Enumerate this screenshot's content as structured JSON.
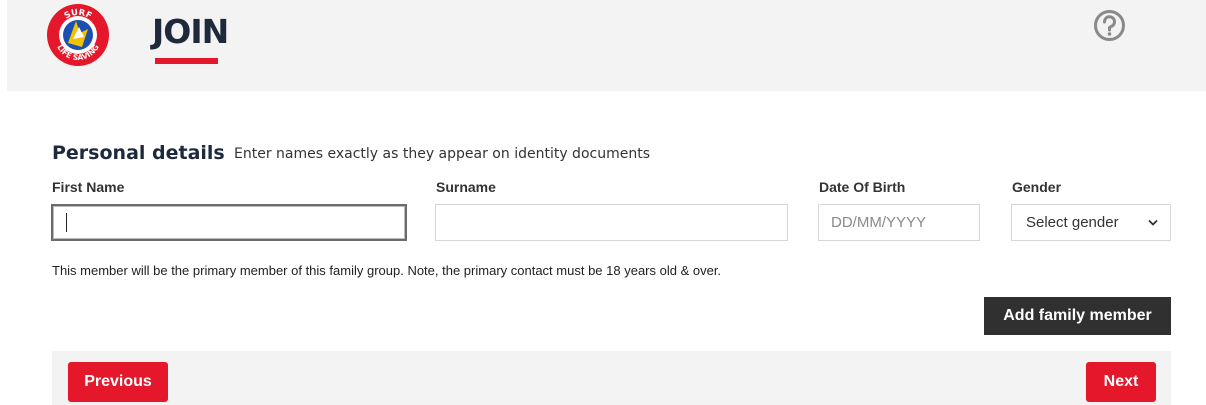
{
  "header": {
    "logo_text_top": "SURF",
    "logo_text_bottom": "LIFE SAVING",
    "title": "JOIN",
    "help_icon": "question-circle-icon"
  },
  "personal": {
    "title": "Personal details",
    "subtitle": "Enter names exactly as they appear on identity documents"
  },
  "fields": {
    "first_name": {
      "label": "First Name",
      "value": ""
    },
    "surname": {
      "label": "Surname",
      "value": ""
    },
    "dob": {
      "label": "Date Of Birth",
      "placeholder": "DD/MM/YYYY"
    },
    "gender": {
      "label": "Gender",
      "selected": "Select gender"
    }
  },
  "note": "This member will be the primary member of this family group. Note, the primary contact must be 18 years old & over.",
  "buttons": {
    "add_family_member": "Add family member",
    "previous": "Previous",
    "next": "Next"
  },
  "colors": {
    "accent": "#e4172b",
    "dark_button": "#303030",
    "panel_bg": "#f3f3f3",
    "heading": "#1e2a3c"
  }
}
